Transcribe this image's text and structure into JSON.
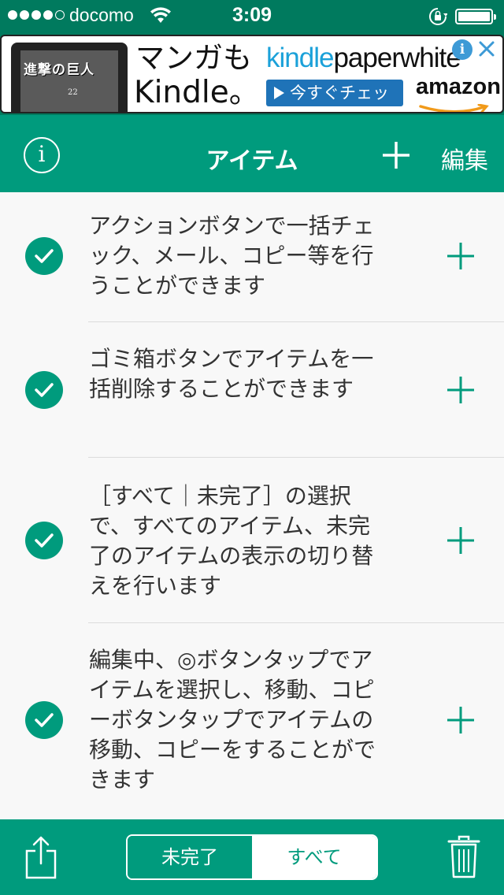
{
  "status_bar": {
    "carrier": "docomo",
    "time": "3:09"
  },
  "ad": {
    "book_title": "進撃の巨人",
    "book_volume": "22",
    "headline_line1": "マンガも",
    "headline_line2": "Kindle。",
    "product_brand": "kindle",
    "product_name": "paperwhite",
    "cta": "今すぐチェック",
    "store": "amazon",
    "info_glyph": "i"
  },
  "navbar": {
    "info_glyph": "i",
    "title": "アイテム",
    "edit_label": "編集"
  },
  "items": [
    {
      "text": "アクションボタンで一括チェック、メール、コピー等を行うことができます",
      "checked": true
    },
    {
      "text": "ゴミ箱ボタンでアイテムを一括削除することができます",
      "checked": true
    },
    {
      "text": "［すべて｜未完了］の選択で、すべてのアイテム、未完了のアイテムの表示の切り替えを行います",
      "checked": true
    },
    {
      "text": "編集中、◎ボタンタップでアイテムを選択し、移動、コピーボタンタップでアイテムの移動、コピーをすることができます",
      "checked": true
    }
  ],
  "toolbar": {
    "segment_incomplete": "未完了",
    "segment_all": "すべて",
    "selected_segment": "すべて"
  },
  "colors": {
    "primary": "#009b7d",
    "status_bar": "#007a5e",
    "text": "#333333"
  },
  "icons": [
    "share-icon",
    "trash-icon",
    "add-icon",
    "info-icon",
    "checkmark-icon",
    "wifi-icon",
    "lock-rotation-icon",
    "battery-icon"
  ]
}
